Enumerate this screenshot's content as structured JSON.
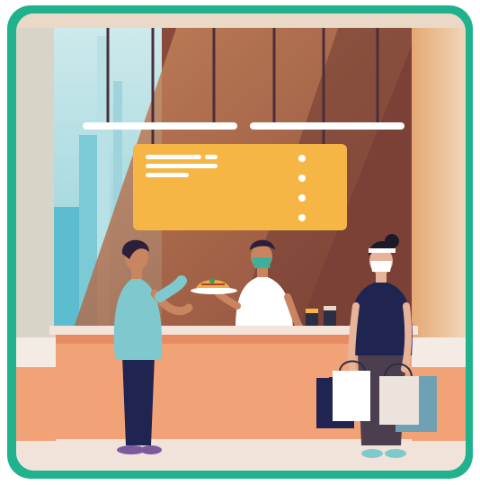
{
  "scene": {
    "subject": "food-counter-illustration",
    "menu_board": {
      "text_lines": 3,
      "dots": 4
    },
    "colors": {
      "frame_border": "#1fb28c",
      "wall_left": "#d9d4c8",
      "glass_blue": "#a9dde2",
      "wall_brown": "#8a4a3a",
      "menu_board": "#f6b646",
      "counter": "#f2a277",
      "floor": "#f1e3da",
      "lamp_bar": "#ffffff"
    }
  }
}
